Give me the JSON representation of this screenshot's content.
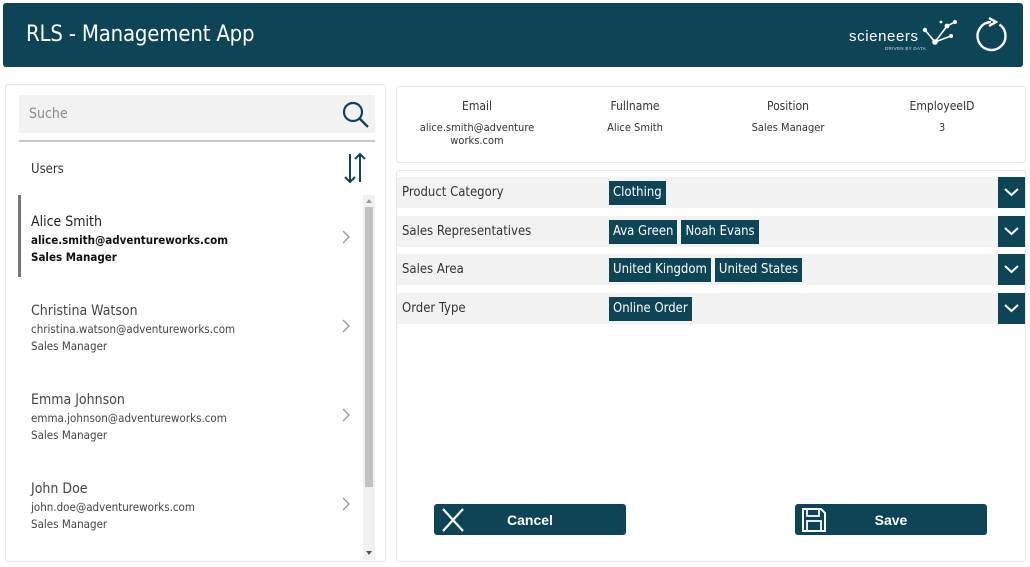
{
  "header": {
    "title": "RLS - Management App",
    "logo_text": "scieneers",
    "logo_tagline": "DRIVEN BY DATA",
    "refresh_icon": "refresh-icon"
  },
  "colors": {
    "primary": "#0e4556",
    "panel_bg": "#f2f2f2",
    "text": "#333333"
  },
  "search": {
    "placeholder": "Suche",
    "value": ""
  },
  "users_section": {
    "label": "Users"
  },
  "users": [
    {
      "name": "Alice Smith",
      "email": "alice.smith@adventureworks.com",
      "position": "Sales Manager",
      "selected": true
    },
    {
      "name": "Christina Watson",
      "email": "christina.watson@adventureworks.com",
      "position": "Sales Manager",
      "selected": false
    },
    {
      "name": "Emma Johnson",
      "email": "emma.johnson@adventureworks.com",
      "position": "Sales Manager",
      "selected": false
    },
    {
      "name": "John Doe",
      "email": "john.doe@adventureworks.com",
      "position": "Sales Manager",
      "selected": false
    }
  ],
  "details": {
    "headers": {
      "email": "Email",
      "fullname": "Fullname",
      "position": "Position",
      "employee_id": "EmployeeID"
    },
    "email_line1": "alice.smith@adventure",
    "email_line2": "works.com",
    "fullname": "Alice Smith",
    "position": "Sales Manager",
    "employee_id": "3"
  },
  "filters": [
    {
      "label": "Product Category",
      "chips": [
        "Clothing"
      ]
    },
    {
      "label": "Sales Representatives",
      "chips": [
        "Ava Green",
        "Noah Evans"
      ]
    },
    {
      "label": "Sales Area",
      "chips": [
        "United Kingdom",
        "United States"
      ]
    },
    {
      "label": "Order Type",
      "chips": [
        "Online Order"
      ]
    }
  ],
  "actions": {
    "cancel": "Cancel",
    "save": "Save"
  }
}
